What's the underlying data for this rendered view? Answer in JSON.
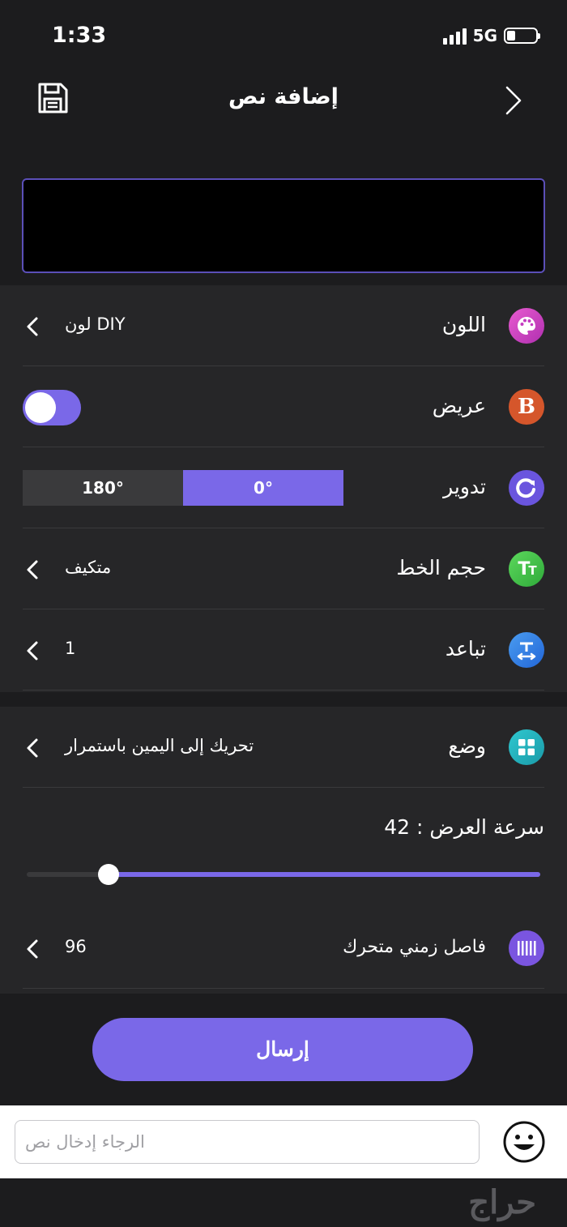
{
  "status_bar": {
    "time": "1:33",
    "network": "5G"
  },
  "nav": {
    "title": "إضافة نص"
  },
  "settings": {
    "color": {
      "label": "اللون",
      "value": "لون DIY"
    },
    "bold": {
      "label": "عريض"
    },
    "rotate": {
      "label": "تدوير",
      "option_a": "180°",
      "option_b": "0°"
    },
    "font_size": {
      "label": "حجم الخط",
      "value": "متكيف"
    },
    "spacing": {
      "label": "تباعد",
      "value": "1"
    }
  },
  "mode": {
    "label": "وضع",
    "value": "تحريك إلى اليمين باستمرار",
    "speed_label": "سرعة العرض",
    "speed_value": "42",
    "speed_fraction": 0.84,
    "interval_label": "فاصل زمني متحرك",
    "interval_value": "96"
  },
  "send_button": "إرسال",
  "text_input": {
    "placeholder": "الرجاء إدخال نص"
  },
  "watermark": "حراج",
  "colors": {
    "accent": "#7a68e8",
    "background": "#1c1c1e",
    "panel": "#262628"
  }
}
